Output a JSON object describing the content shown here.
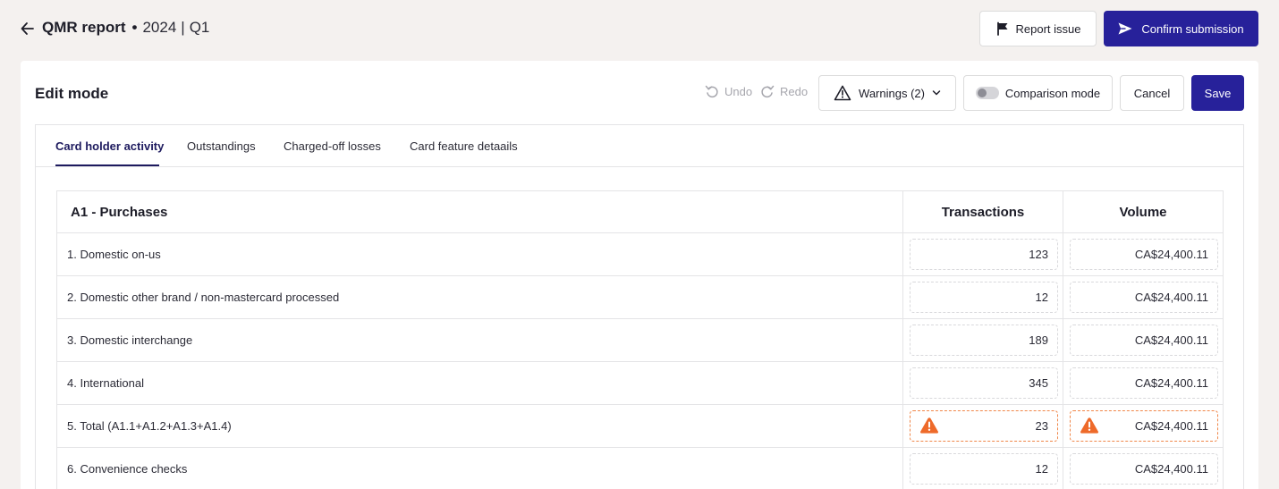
{
  "header": {
    "title": "QMR report",
    "dot": "•",
    "year": "2024",
    "separator": "|",
    "quarter": "Q1",
    "report_issue_label": "Report issue",
    "confirm_label": "Confirm submission"
  },
  "toolbar": {
    "mode_title": "Edit mode",
    "undo_label": "Undo",
    "redo_label": "Redo",
    "warnings_label": "Warnings (2)",
    "comparison_label": "Comparison mode",
    "cancel_label": "Cancel",
    "save_label": "Save"
  },
  "tabs": [
    {
      "label": "Card holder activity",
      "active": true
    },
    {
      "label": "Outstandings",
      "active": false
    },
    {
      "label": "Charged-off losses",
      "active": false
    },
    {
      "label": "Card feature detaails",
      "active": false
    }
  ],
  "table": {
    "section_title": "A1 - Purchases",
    "col_transactions": "Transactions",
    "col_volume": "Volume",
    "rows": [
      {
        "label": "1. Domestic on-us",
        "transactions": "123",
        "volume": "CA$24,400.11",
        "warning": false
      },
      {
        "label": "2. Domestic other brand / non-mastercard processed",
        "transactions": "12",
        "volume": "CA$24,400.11",
        "warning": false
      },
      {
        "label": "3. Domestic interchange",
        "transactions": "189",
        "volume": "CA$24,400.11",
        "warning": false
      },
      {
        "label": "4. International",
        "transactions": "345",
        "volume": "CA$24,400.11",
        "warning": false
      },
      {
        "label": "5. Total (A1.1+A1.2+A1.3+A1.4)",
        "transactions": "23",
        "volume": "CA$24,400.11",
        "warning": true
      },
      {
        "label": "6. Convenience checks",
        "transactions": "12",
        "volume": "CA$24,400.11",
        "warning": false
      }
    ]
  },
  "colors": {
    "primary": "#27219a",
    "active_tab": "#1d1a5e",
    "warning": "#f0874a",
    "background": "#f4f1ef"
  },
  "icons": {
    "back": "arrow-left-icon",
    "report": "flag-icon",
    "confirm": "send-icon",
    "undo": "undo-icon",
    "redo": "redo-icon",
    "warnings": "warning-triangle-icon",
    "warnings_toggle": "chevron-down-icon",
    "field_warning": "warning-filled-icon"
  }
}
